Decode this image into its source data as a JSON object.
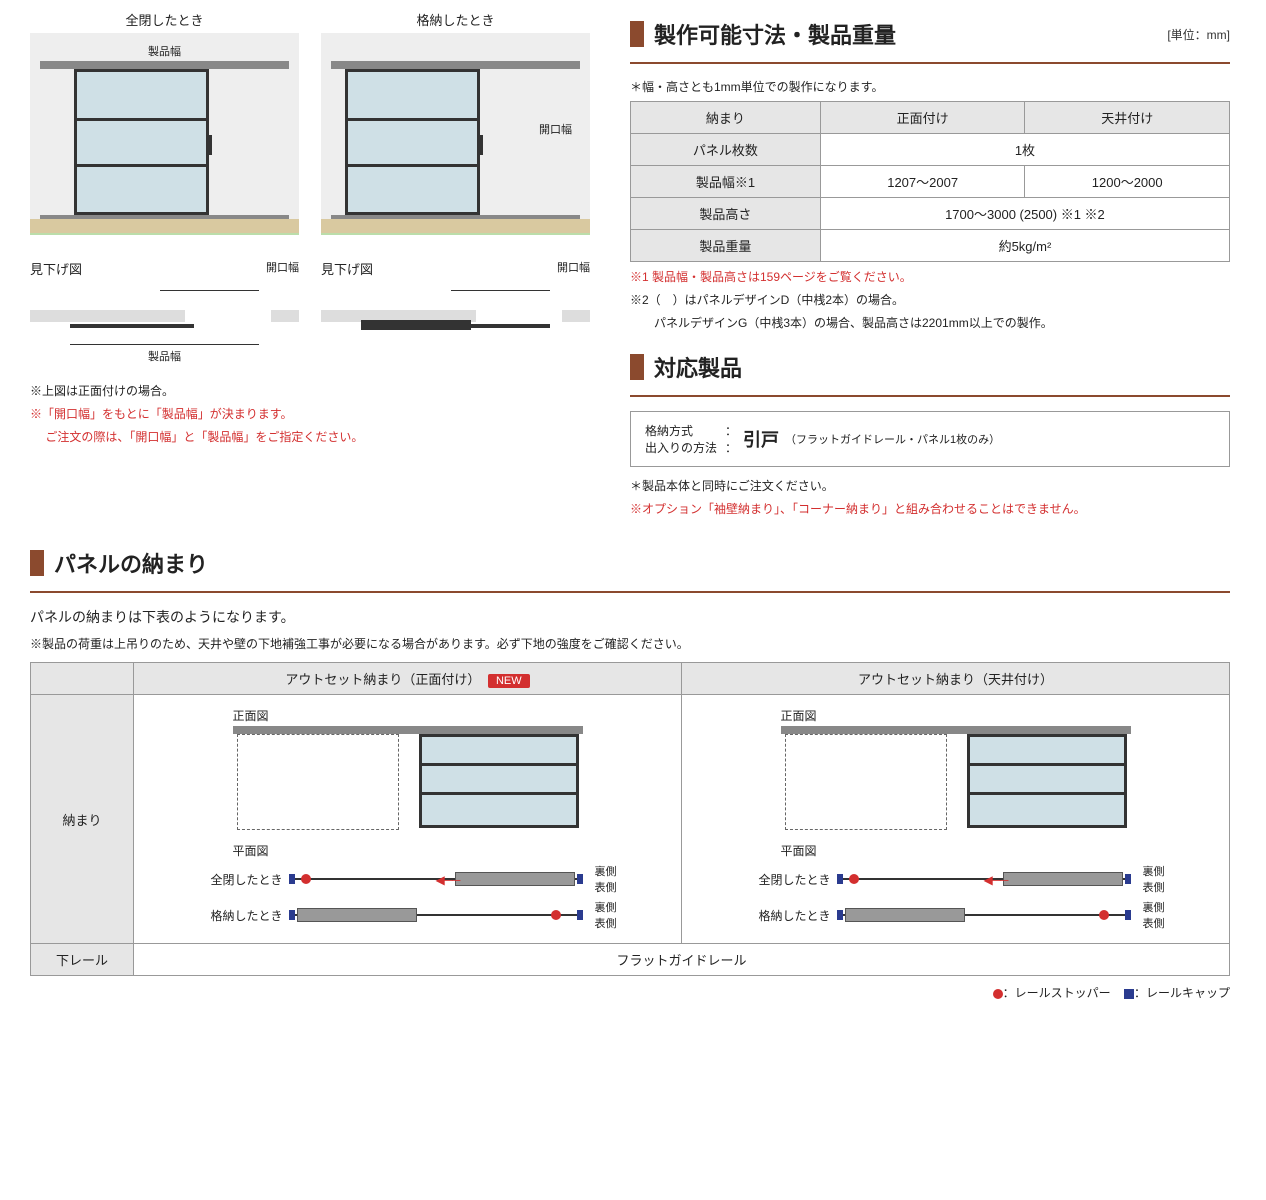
{
  "top": {
    "closed_caption": "全閉したとき",
    "stored_caption": "格納したとき",
    "product_width": "製品幅",
    "opening_width": "開口幅",
    "plan_caption": "見下げ図",
    "note_above": "※上図は正面付けの場合。",
    "note_red1": "※「開口幅」をもとに「製品幅」が決まります。",
    "note_red2": "　 ご注文の際は、「開口幅」と「製品幅」をご指定ください。"
  },
  "spec": {
    "title": "製作可能寸法・製品重量",
    "unit": "[単位：mm]",
    "lead": "＊幅・高さとも1mm単位での製作になります。",
    "headers": {
      "osamari": "納まり",
      "front": "正面付け",
      "ceiling": "天井付け"
    },
    "rows": {
      "panels_key": "パネル枚数",
      "panels_val": "1枚",
      "width_key": "製品幅※1",
      "width_front": "1207～2007",
      "width_ceiling": "1200～2000",
      "height_key": "製品高さ",
      "height_val": "1700～3000 (2500) ※1 ※2",
      "weight_key": "製品重量",
      "weight_val": "約5kg/m²"
    },
    "foot1": "※1 製品幅・製品高さは159ページをご覧ください。",
    "foot2": "※2（　）はパネルデザインD（中桟2本）の場合。",
    "foot3": "　　パネルデザインG（中桟3本）の場合、製品高さは2201mm以上での製作。"
  },
  "compat": {
    "title": "対応製品",
    "k1": "格納方式",
    "k2": "出入りの方法",
    "colon": "：",
    "big": "引戸",
    "detail": "（フラットガイドレール・パネル1枚のみ）",
    "note1": "＊製品本体と同時にご注文ください。",
    "note2": "※オプション「袖壁納まり」、「コーナー納まり」と組み合わせることはできません。"
  },
  "panel_section": {
    "title": "パネルの納まり",
    "lead": "パネルの納まりは下表のようになります。",
    "note": "※製品の荷重は上吊りのため、天井や壁の下地補強工事が必要になる場合があります。必ず下地の強度をご確認ください。"
  },
  "ptable": {
    "col1": "アウトセット納まり（正面付け）",
    "new": "NEW",
    "col2": "アウトセット納まり（天井付け）",
    "row_osamari": "納まり",
    "row_rail": "下レール",
    "front_view": "正面図",
    "plan_view": "平面図",
    "closed": "全閉したとき",
    "stored": "格納したとき",
    "back": "裏側",
    "front": "表側",
    "rail_val": "フラットガイドレール"
  },
  "legend": {
    "stopper": "：レールストッパー",
    "cap": "：レールキャップ"
  }
}
